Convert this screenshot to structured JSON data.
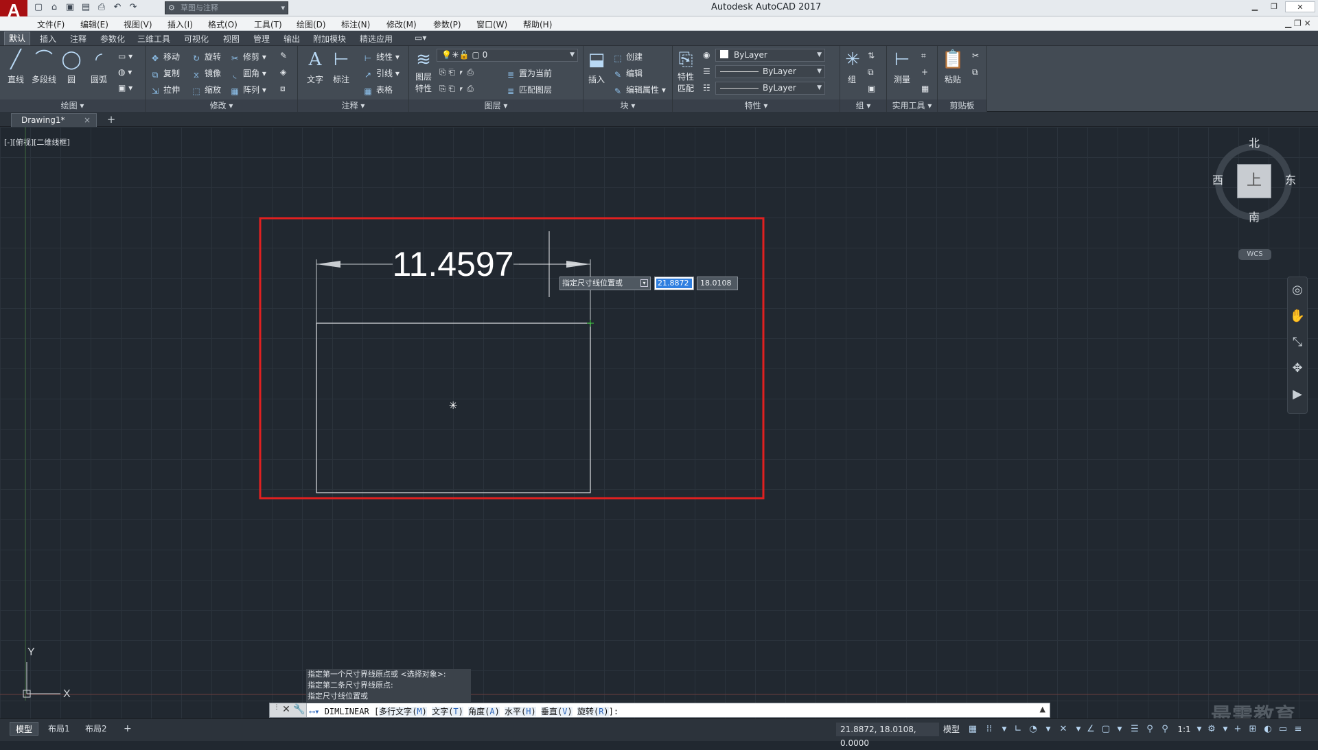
{
  "app": {
    "logo": "A",
    "title": "Autodesk AutoCAD 2017",
    "workspace": "草图与注释"
  },
  "menu": [
    "文件(F)",
    "编辑(E)",
    "视图(V)",
    "插入(I)",
    "格式(O)",
    "工具(T)",
    "绘图(D)",
    "标注(N)",
    "修改(M)",
    "参数(P)",
    "窗口(W)",
    "帮助(H)"
  ],
  "ribbon_tabs": [
    "默认",
    "插入",
    "注释",
    "参数化",
    "三维工具",
    "可视化",
    "视图",
    "管理",
    "输出",
    "附加模块",
    "精选应用"
  ],
  "ribbon": {
    "draw": {
      "line": "直线",
      "polyline": "多段线",
      "circle": "圆",
      "arc": "圆弧",
      "label": "绘图"
    },
    "modify": {
      "move": "移动",
      "rotate": "旋转",
      "trim": "修剪",
      "copy": "复制",
      "mirror": "镜像",
      "fillet": "圆角",
      "stretch": "拉伸",
      "scale": "缩放",
      "array": "阵列",
      "label": "修改"
    },
    "annotation": {
      "text": "文字",
      "dimension": "标注",
      "linear": "线性",
      "leader": "引线",
      "table": "表格",
      "label": "注释"
    },
    "layers": {
      "properties_line1": "图层",
      "properties_line2": "特性",
      "current_layer": "0",
      "set_current": "置为当前",
      "match_layer": "匹配图层",
      "label": "图层"
    },
    "block": {
      "insert": "插入",
      "create": "创建",
      "edit": "编辑",
      "edit_attributes": "编辑属性",
      "label": "块"
    },
    "properties": {
      "match_line1": "特性",
      "match_line2": "匹配",
      "color": "ByLayer",
      "linetype": "ByLayer",
      "lineweight": "ByLayer",
      "label": "特性"
    },
    "groups": {
      "group": "组",
      "label": "组"
    },
    "utilities": {
      "measure": "测量",
      "label": "实用工具"
    },
    "clipboard": {
      "paste": "粘贴",
      "label": "剪贴板"
    }
  },
  "doc_tab": {
    "name": "Drawing1*",
    "close": "×",
    "new": "+"
  },
  "viewport_label": "[-][俯视][二维线框]",
  "drawing": {
    "dimension_value": "11.4597",
    "prompt": "指定尺寸线位置或",
    "input_x": "21.8872",
    "input_y": "18.0108",
    "ucs_y": "Y",
    "ucs_x": "X"
  },
  "viewcube": {
    "north": "北",
    "south": "南",
    "west": "西",
    "east": "东",
    "face": "上",
    "wcs": "WCS"
  },
  "command_history": [
    "指定第一个尺寸界线原点或 <选择对象>:",
    "指定第二条尺寸界线原点:",
    "指定尺寸线位置或"
  ],
  "command_line": {
    "command": "DIMLINEAR",
    "options": [
      {
        "label": "多行文字",
        "key": "M"
      },
      {
        "label": "文字",
        "key": "T"
      },
      {
        "label": "角度",
        "key": "A"
      },
      {
        "label": "水平",
        "key": "H"
      },
      {
        "label": "垂直",
        "key": "V"
      },
      {
        "label": "旋转",
        "key": "R"
      }
    ]
  },
  "layout_tabs": [
    "模型",
    "布局1",
    "布局2"
  ],
  "status": {
    "coordinates": "21.8872, 18.0108, 0.0000",
    "model": "模型",
    "scale": "1:1"
  },
  "watermark": "最需教育"
}
